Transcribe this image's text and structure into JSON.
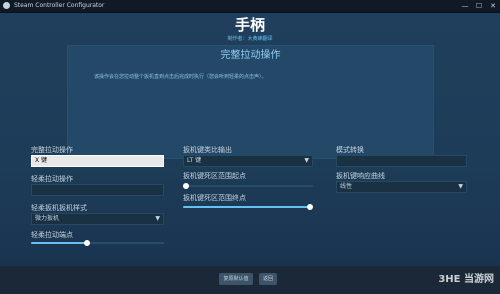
{
  "window": {
    "title": "Steam Controller Configurator",
    "minimize": "—",
    "maximize": "☐",
    "close": "✕"
  },
  "header": {
    "title": "手柄",
    "subtitle": "制作者：大黄蜂翻译"
  },
  "description": {
    "title": "完整拉动操作",
    "text": "该操作会在您拉动整个扳机直到点击后完成时执行（您会听到轻柔的点击声）。"
  },
  "left": {
    "full_pull_label": "完整拉动操作",
    "full_pull_value": "X 键",
    "soft_pull_label": "轻柔拉动操作",
    "soft_pull_value": "",
    "soft_style_label": "轻柔扳机扳机样式",
    "soft_style_value": "微力扳机",
    "soft_threshold_label": "轻柔拉动端点",
    "soft_threshold_value": 0.42
  },
  "middle": {
    "analog_output_label": "扳机键类比输出",
    "analog_output_value": "LT 键",
    "range_start_label": "扳机键死区范围起点",
    "range_start_value": 0.02,
    "range_end_label": "扳机键死区范围终点",
    "range_end_value": 0.98
  },
  "right": {
    "mode_shift_label": "模式转换",
    "mode_shift_value": "",
    "response_curve_label": "扳机键响应曲线",
    "response_curve_value": "线性"
  },
  "footer": {
    "restore_default": "复原默认值",
    "back": "返回",
    "watermark": "当游网",
    "watermark_logo": "3HE"
  },
  "colors": {
    "accent": "#66c0f4",
    "background": "#1b2838"
  }
}
